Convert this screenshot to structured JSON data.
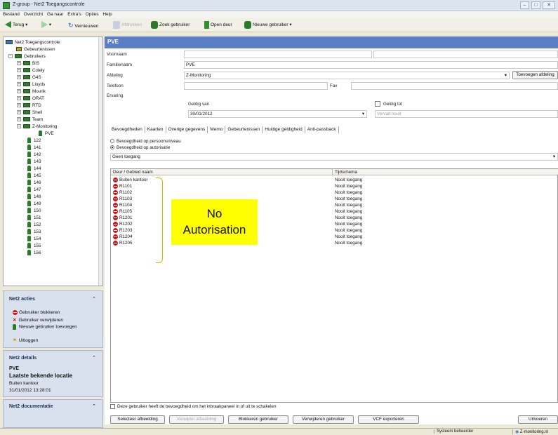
{
  "window": {
    "title": "Z-group - Net2 Toegangscontrole"
  },
  "menu": [
    "Bestand",
    "Overzicht",
    "Ga naar",
    "Extra's",
    "Opties",
    "Help"
  ],
  "toolbar": {
    "back": "Terug",
    "refresh": "Vernieuwen",
    "delete": "Afdrukken",
    "find_user": "Zoek gebruiker",
    "open_door": "Open deur",
    "new_user": "Nieuwe gebruiker"
  },
  "tree": {
    "root": "Net2 Toegangscontrole",
    "events": "Gebeurtenissen",
    "users": "Gebruikers",
    "groups": [
      "BIS",
      "Colely",
      "G4S",
      "Lloyds",
      "Mourik",
      "ORAT",
      "RTD",
      "Shell",
      "Team",
      "Z-Monitoring"
    ],
    "selected_user": "PVE",
    "user_ids": [
      "122",
      "141",
      "142",
      "143",
      "144",
      "145",
      "146",
      "147",
      "148",
      "149",
      "150",
      "151",
      "152",
      "153",
      "154",
      "155",
      "156"
    ]
  },
  "acties": {
    "title": "Net2 acties",
    "items": [
      "Gebruiker blokkeren",
      "Gebruiker verwijderen",
      "Nieuwe gebruiker toevoegen",
      "Uitloggen"
    ]
  },
  "details": {
    "title": "Net2 details",
    "user": "PVE",
    "last_location_label": "Laatste bekende locatie",
    "location": "Buiten kantoor",
    "timestamp": "31/01/2012 13:28:01"
  },
  "documentatie": {
    "title": "Net2 documentatie"
  },
  "header": {
    "title": "PVE"
  },
  "form": {
    "voornaam_label": "Voornaam",
    "familienaam_label": "Familienaam",
    "familienaam_value": "PVE",
    "afdeling_label": "Afdeling",
    "afdeling_value": "Z-Monitoring",
    "toevoegen_afdeling": "Toevoegen afdeling",
    "telefoon_label": "Telefoon",
    "fax_label": "Fax",
    "ervaring_label": "Ervaring",
    "geldig_van_label": "Geldig van",
    "geldig_van_value": "30/01/2012",
    "geldig_tot_label": "Geldig tot",
    "vervalt_nooit": "Vervalt nooit"
  },
  "tabs": [
    "Bevoegdheden",
    "Kaarten",
    "Overige gegevens",
    "Memo",
    "Gebeurtenissen",
    "Huidige geldigheid",
    "Anti-passback"
  ],
  "bevoegdheden": {
    "option1": "Bevoegdheid op persoonsniveau",
    "option2": "Bevoegdheid op autorisatie",
    "dropdown_value": "Geen toegang"
  },
  "table": {
    "headers": [
      "Deur / Gebied naam",
      "Tijdschema"
    ],
    "rows": [
      [
        "Buiten kantoor",
        "Nooit toegang"
      ],
      [
        "R1101",
        "Nooit toegang"
      ],
      [
        "R1102",
        "Nooit toegang"
      ],
      [
        "R1103",
        "Nooit toegang"
      ],
      [
        "R1104",
        "Nooit toegang"
      ],
      [
        "R1105",
        "Nooit toegang"
      ],
      [
        "R1201",
        "Nooit toegang"
      ],
      [
        "R1202",
        "Nooit toegang"
      ],
      [
        "R1203",
        "Nooit toegang"
      ],
      [
        "R1204",
        "Nooit toegang"
      ],
      [
        "R1205",
        "Nooit toegang"
      ]
    ]
  },
  "callout": {
    "line1": "No",
    "line2": "Autorisation"
  },
  "checkbox_label": "Deze gebruiker heeft de bevoegdheid om het inbraakpaneel in of uit te schakelen",
  "buttons": {
    "select_image": "Selecteer afbeelding",
    "remove_image": "Verwijder afbeelding",
    "block_user": "Blokkeren gebruiker",
    "delete_user": "Verwijderen gebruiker",
    "export_vcf": "VCF exporteren",
    "uitvoeren": "Uitvoeren"
  },
  "status": {
    "user": "Systeem beheerder",
    "site": "Z-monitoring.nl"
  },
  "colors": {
    "header": "#5b7fc6",
    "callout": "#ffff00",
    "deny": "#d01414",
    "tree_icon": "#2f7a2f"
  }
}
